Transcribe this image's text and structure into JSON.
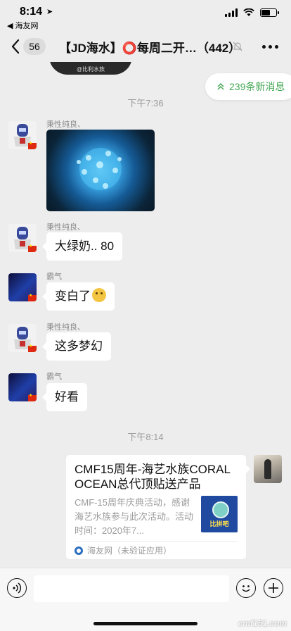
{
  "status_bar": {
    "time": "8:14",
    "back_app": "◀ 海友网",
    "battery_level": 0.6
  },
  "nav": {
    "unread_count": "56",
    "title": "【JD海水】⭕每周二开…（442）"
  },
  "prev_image_caption": "@比利水族",
  "new_messages_label": "239条新消息",
  "timestamps": [
    "下午7:36",
    "下午8:14"
  ],
  "messages": [
    {
      "sender": "秉性纯良、",
      "kind": "image"
    },
    {
      "sender": "秉性纯良、",
      "text": "大绿奶.. 80"
    },
    {
      "sender": "霸气",
      "text": "变白了"
    },
    {
      "sender": "秉性纯良、",
      "text": "这多梦幻"
    },
    {
      "sender": "霸气",
      "text": "好看"
    }
  ],
  "link_card": {
    "title": "CMF15周年-海艺水族CORAL OCEAN总代顶贴送产品",
    "description": "CMF-15周年庆典活动，感谢海艺水族参与此次活动。活动时间：2020年7...",
    "thumb_text": "比拼吧",
    "source": "海友网（未验证应用）"
  },
  "watermark": "cmf151.com",
  "colors": {
    "background": "#ededed",
    "bubble": "#ffffff",
    "accent_green": "#43a854"
  }
}
